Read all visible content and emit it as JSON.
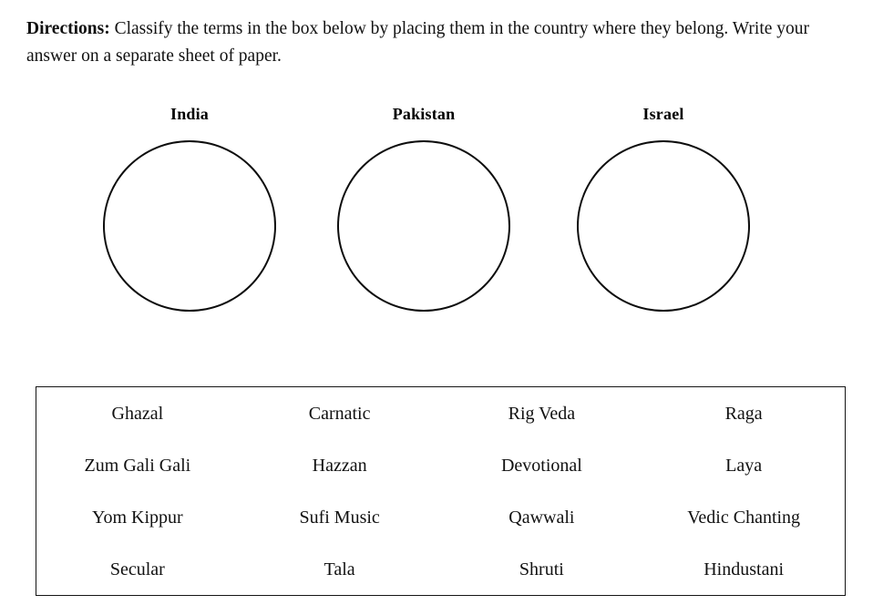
{
  "worksheet": {
    "directions": {
      "label": "Directions:",
      "text": " Classify the terms in the box below by placing them in the country where they belong. Write your answer on a separate sheet of paper."
    },
    "categories": [
      {
        "name": "India"
      },
      {
        "name": "Pakistan"
      },
      {
        "name": "Israel"
      }
    ],
    "word_bank": {
      "rows": [
        [
          "Ghazal",
          "Carnatic",
          "Rig Veda",
          "Raga"
        ],
        [
          "Zum Gali Gali",
          "Hazzan",
          "Devotional",
          "Laya"
        ],
        [
          "Yom Kippur",
          "Sufi Music",
          "Qawwali",
          "Vedic Chanting"
        ],
        [
          "Secular",
          "Tala",
          "Shruti",
          "Hindustani"
        ]
      ]
    }
  },
  "colors": {
    "page_background": "#ffffff",
    "text": "#111111",
    "stroke": "#0d0d0d",
    "box_border": "#151515"
  }
}
